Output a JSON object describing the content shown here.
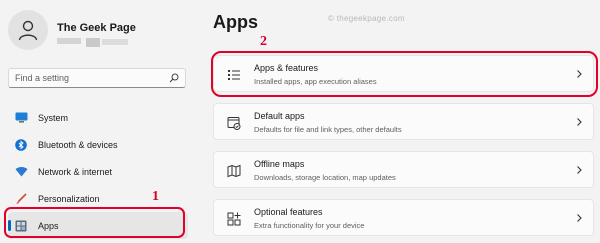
{
  "user": {
    "name": "The Geek Page",
    "email": ""
  },
  "search": {
    "placeholder": "Find a setting"
  },
  "nav": {
    "items": [
      {
        "label": "System",
        "icon": "system-monitor-icon"
      },
      {
        "label": "Bluetooth & devices",
        "icon": "bluetooth-icon"
      },
      {
        "label": "Network & internet",
        "icon": "wifi-icon"
      },
      {
        "label": "Personalization",
        "icon": "brush-icon"
      },
      {
        "label": "Apps",
        "icon": "apps-icon",
        "active": true
      }
    ]
  },
  "page": {
    "title": "Apps",
    "watermark": "© thegeekpage.com"
  },
  "cards": [
    {
      "title": "Apps & features",
      "subtitle": "Installed apps, app execution aliases",
      "icon": "apps-features-icon"
    },
    {
      "title": "Default apps",
      "subtitle": "Defaults for file and link types, other defaults",
      "icon": "default-apps-icon"
    },
    {
      "title": "Offline maps",
      "subtitle": "Downloads, storage location, map updates",
      "icon": "map-icon"
    },
    {
      "title": "Optional features",
      "subtitle": "Extra functionality for your device",
      "icon": "optional-features-icon"
    }
  ],
  "annotations": {
    "apps_step": "1",
    "features_step": "2"
  },
  "colors": {
    "accent": "#0067c0",
    "annotation": "#e0002a",
    "background": "#f3f3f3"
  }
}
